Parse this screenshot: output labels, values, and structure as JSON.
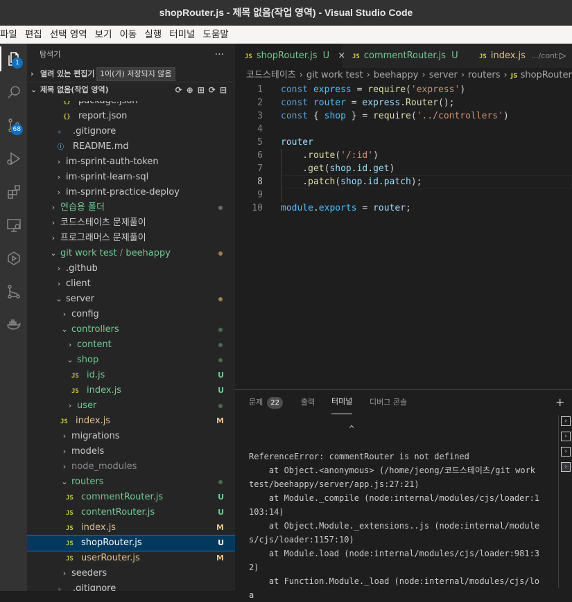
{
  "window": {
    "title": "shopRouter.js - 제목 없음(작업 영역) - Visual Studio Code"
  },
  "menu": [
    "파일",
    "편집",
    "선택 영역",
    "보기",
    "이동",
    "실행",
    "터미널",
    "도움말"
  ],
  "activity": {
    "explorer_badge": "1",
    "scm_badge": "68"
  },
  "sidebar": {
    "header": "탐색기",
    "more": "···",
    "open_editors": "열려 있는 편집기",
    "open_editors_tooltip": "1이(가) 저장되지 않음",
    "workspace": "제목 없음(작업 영역)",
    "tree": [
      {
        "label": "package.json",
        "type": "json"
      },
      {
        "label": "report.json",
        "type": "json"
      },
      {
        "label": ".gitignore",
        "type": "git"
      },
      {
        "label": "README.md",
        "type": "info"
      },
      {
        "label": "im-sprint-auth-token",
        "type": "folder"
      },
      {
        "label": "im-sprint-learn-sql",
        "type": "folder"
      },
      {
        "label": "im-sprint-practice-deploy",
        "type": "folder"
      },
      {
        "label": "연습용 폴더",
        "type": "folder"
      },
      {
        "label": "코드스테이츠 문제풀이",
        "type": "folder"
      },
      {
        "label": "프로그래머스 문제풀이",
        "type": "folder"
      },
      {
        "label": "git work test",
        "suffix": "beehappy",
        "type": "folder-open"
      },
      {
        "label": ".github",
        "type": "folder"
      },
      {
        "label": "client",
        "type": "folder"
      },
      {
        "label": "server",
        "type": "folder-open"
      },
      {
        "label": "config",
        "type": "folder"
      },
      {
        "label": "controllers",
        "type": "folder-open"
      },
      {
        "label": "content",
        "type": "folder"
      },
      {
        "label": "shop",
        "type": "folder-open"
      },
      {
        "label": "id.js",
        "type": "js",
        "deco": "U"
      },
      {
        "label": "index.js",
        "type": "js",
        "deco": "U"
      },
      {
        "label": "user",
        "type": "folder"
      },
      {
        "label": "index.js",
        "type": "js",
        "deco": "M"
      },
      {
        "label": "migrations",
        "type": "folder"
      },
      {
        "label": "models",
        "type": "folder"
      },
      {
        "label": "node_modules",
        "type": "folder"
      },
      {
        "label": "routers",
        "type": "folder-open"
      },
      {
        "label": "commentRouter.js",
        "type": "js",
        "deco": "U"
      },
      {
        "label": "contentRouter.js",
        "type": "js",
        "deco": "U"
      },
      {
        "label": "index.js",
        "type": "js",
        "deco": "M"
      },
      {
        "label": "shopRouter.js",
        "type": "js",
        "deco": "U"
      },
      {
        "label": "userRouter.js",
        "type": "js",
        "deco": "M"
      },
      {
        "label": "seeders",
        "type": "folder"
      },
      {
        "label": ".gitignore",
        "type": "git"
      }
    ]
  },
  "tabs": [
    {
      "icon": "JS",
      "label": "shopRouter.js",
      "deco": "U",
      "close": "×"
    },
    {
      "icon": "JS",
      "label": "commentRouter.js",
      "deco": "U"
    },
    {
      "icon": "JS",
      "label": "index.js",
      "detail": ".../cont"
    }
  ],
  "breadcrumb": [
    "코드스테이츠",
    "git work test",
    "beehappy",
    "server",
    "routers",
    "shopRouter.js"
  ],
  "editor": {
    "line_numbers": [
      "1",
      "2",
      "3",
      "4",
      "5",
      "6",
      "7",
      "8",
      "9",
      "10"
    ],
    "current_line": "8"
  },
  "panel": {
    "tabs": [
      "문제",
      "출력",
      "터미널",
      "디버그 콘솔"
    ],
    "problems_count": "22",
    "active_tab": "터미널",
    "terminal_lines": [
      "                    ^",
      "",
      "ReferenceError: commentRouter is not defined",
      "    at Object.<anonymous> (/home/jeong/코드스테이츠/git work test/beehappy/server/app.js:27:21)",
      "    at Module._compile (node:internal/modules/cjs/loader:1103:14)",
      "    at Object.Module._extensions..js (node:internal/modules/cjs/loader:1157:10)",
      "    at Module.load (node:internal/modules/cjs/loader:981:32)",
      "    at Function.Module._load (node:internal/modules/cjs/loa"
    ]
  }
}
